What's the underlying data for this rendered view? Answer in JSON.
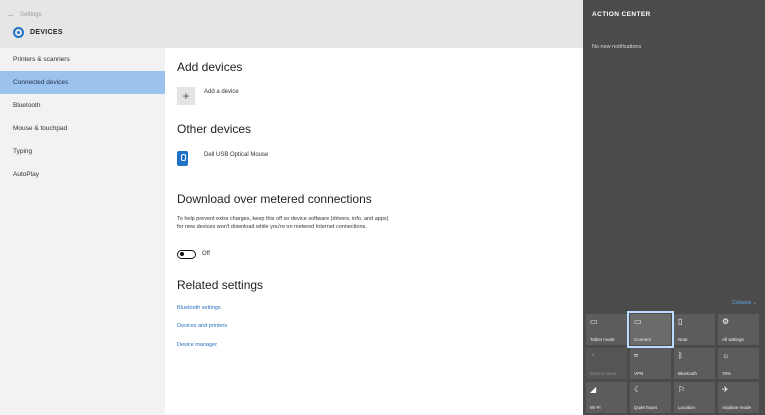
{
  "window": {
    "back_label": "Settings",
    "back_arrow": "←",
    "section_title": "DEVICES"
  },
  "sidebar": {
    "items": [
      {
        "label": "Printers & scanners",
        "active": false
      },
      {
        "label": "Connected devices",
        "active": true
      },
      {
        "label": "Bluetooth",
        "active": false
      },
      {
        "label": "Mouse & touchpad",
        "active": false
      },
      {
        "label": "Typing",
        "active": false
      },
      {
        "label": "AutoPlay",
        "active": false
      }
    ]
  },
  "main": {
    "add_devices": {
      "heading": "Add devices",
      "button_symbol": "+",
      "button_label": "Add a device"
    },
    "other_devices": {
      "heading": "Other devices",
      "device_name": "Dell USB Optical Mouse"
    },
    "metered": {
      "heading": "Download over metered connections",
      "description": "To help prevent extra charges, keep this off so device software (drivers, info, and apps) for new devices won't download while you're on metered Internet connections.",
      "toggle_state": "Off"
    },
    "related": {
      "heading": "Related settings",
      "links": [
        "Bluetooth settings",
        "Devices and printers",
        "Device manager"
      ]
    }
  },
  "action_center": {
    "title": "ACTION CENTER",
    "subtitle": "No new notifications",
    "collapse_label": "Collapse",
    "collapse_arrow": "⌄",
    "tiles": [
      {
        "label": "Tablet mode",
        "icon": "▭",
        "icon_name": "tablet-mode-icon",
        "state": "on"
      },
      {
        "label": "Connect",
        "icon": "▭",
        "icon_name": "connect-icon",
        "state": "selected"
      },
      {
        "label": "Note",
        "icon": "▯",
        "icon_name": "note-icon",
        "state": "on"
      },
      {
        "label": "All settings",
        "icon": "⚙",
        "icon_name": "settings-icon",
        "state": "on"
      },
      {
        "label": "Battery saver",
        "icon": "◔",
        "icon_name": "battery-saver-icon",
        "state": "dim"
      },
      {
        "label": "VPN",
        "icon": "≈",
        "icon_name": "vpn-icon",
        "state": "on"
      },
      {
        "label": "Bluetooth",
        "icon": "ᛒ",
        "icon_name": "bluetooth-icon",
        "state": "on"
      },
      {
        "label": "75%",
        "icon": "☼",
        "icon_name": "brightness-icon",
        "state": "on"
      },
      {
        "label": "Wi-Fi",
        "icon": "◢",
        "icon_name": "wifi-icon",
        "state": "on"
      },
      {
        "label": "Quiet hours",
        "icon": "☾",
        "icon_name": "quiet-hours-icon",
        "state": "on"
      },
      {
        "label": "Location",
        "icon": "⚐",
        "icon_name": "location-icon",
        "state": "on"
      },
      {
        "label": "Airplane mode",
        "icon": "✈",
        "icon_name": "airplane-icon",
        "state": "on"
      }
    ]
  },
  "colors": {
    "accent": "#1e73c8",
    "sidebar_active": "#9cc3ee",
    "action_center_bg": "#4b4b4b",
    "link": "#2a6fc0"
  }
}
